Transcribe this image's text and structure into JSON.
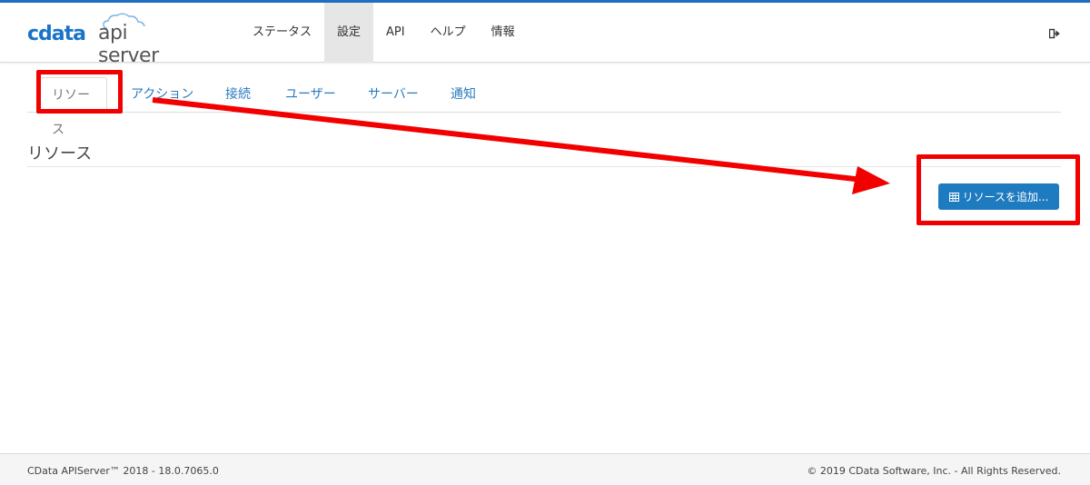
{
  "header": {
    "logo_brand": "cdata",
    "logo_product": "api server",
    "nav": [
      {
        "label": "ステータス",
        "active": false
      },
      {
        "label": "設定",
        "active": true
      },
      {
        "label": "API",
        "active": false
      },
      {
        "label": "ヘルプ",
        "active": false
      },
      {
        "label": "情報",
        "active": false
      }
    ],
    "logout_icon": "sign-out-icon"
  },
  "tabs": [
    {
      "label": "リソース",
      "active": true
    },
    {
      "label": "アクション",
      "active": false
    },
    {
      "label": "接続",
      "active": false
    },
    {
      "label": "ユーザー",
      "active": false
    },
    {
      "label": "サーバー",
      "active": false
    },
    {
      "label": "通知",
      "active": false
    }
  ],
  "section": {
    "title": "リソース",
    "add_button_label": "リソースを追加...",
    "add_button_icon": "table-icon"
  },
  "footer": {
    "left": "CData APIServer™ 2018 - 18.0.7065.0",
    "right": "© 2019 CData Software, Inc. - All Rights Reserved."
  },
  "colors": {
    "accent": "#1f7bc0",
    "annotation": "#f20000",
    "top_line": "#1f6fc0"
  }
}
